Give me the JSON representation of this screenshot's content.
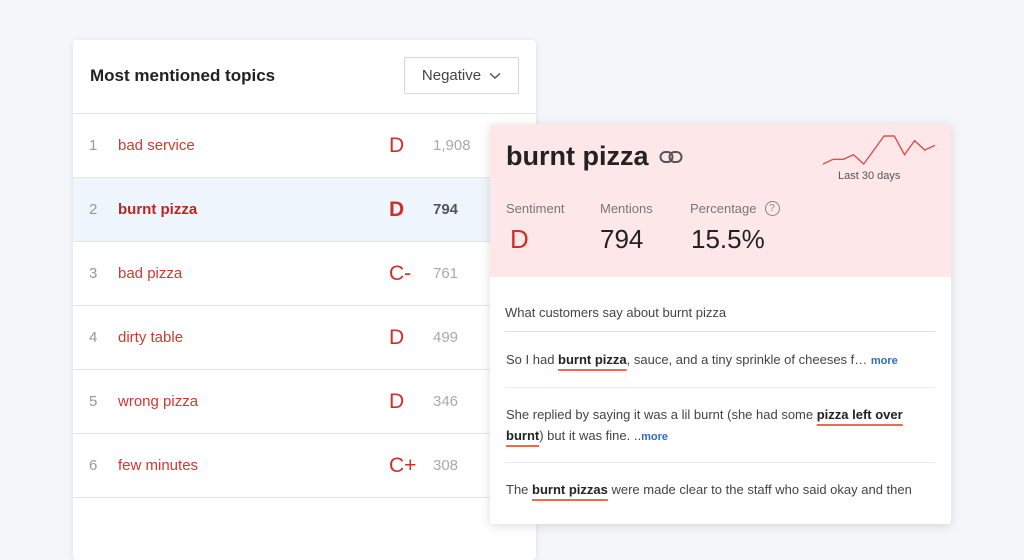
{
  "topics": {
    "title": "Most mentioned topics",
    "filter": "Negative",
    "rows": [
      {
        "rank": "1",
        "label": "bad service",
        "grade": "D",
        "count": "1,908"
      },
      {
        "rank": "2",
        "label": "burnt pizza",
        "grade": "D",
        "count": "794"
      },
      {
        "rank": "3",
        "label": "bad pizza",
        "grade": "C-",
        "count": "761"
      },
      {
        "rank": "4",
        "label": "dirty table",
        "grade": "D",
        "count": "499"
      },
      {
        "rank": "5",
        "label": "wrong pizza",
        "grade": "D",
        "count": "346"
      },
      {
        "rank": "6",
        "label": "few minutes",
        "grade": "C+",
        "count": "308"
      }
    ]
  },
  "detail": {
    "title": "burnt pizza",
    "sparkline_caption": "Last 30 days",
    "sparkline_color": "#d9534f",
    "sparkline_values": [
      3,
      4,
      4,
      5,
      3,
      6,
      9,
      9,
      5,
      8,
      6,
      7
    ],
    "sentiment_label": "Sentiment",
    "sentiment_value": "D",
    "mentions_label": "Mentions",
    "mentions_value": "794",
    "percentage_label": "Percentage",
    "percentage_value": "15.5%",
    "says_title": "What customers say about burnt pizza",
    "quotes": [
      {
        "pre": "So I had ",
        "highlight": "burnt pizza",
        "post": ", sauce, and a tiny sprinkle of cheeses f… ",
        "more": "more"
      },
      {
        "pre": "She replied by saying it was a lil burnt (she had some ",
        "highlight": "pizza left over burnt",
        "post": ") but it was fine. ..",
        "more": "more"
      },
      {
        "pre": "The ",
        "highlight": "burnt pizzas",
        "post": " were made clear to the staff who said okay and then",
        "more": ""
      }
    ]
  },
  "colors": {
    "accent_red": "#c8322a",
    "selected_row_bg": "#eef5fc",
    "detail_header_bg": "#fde7e8",
    "link_blue": "#2a6ebd"
  }
}
